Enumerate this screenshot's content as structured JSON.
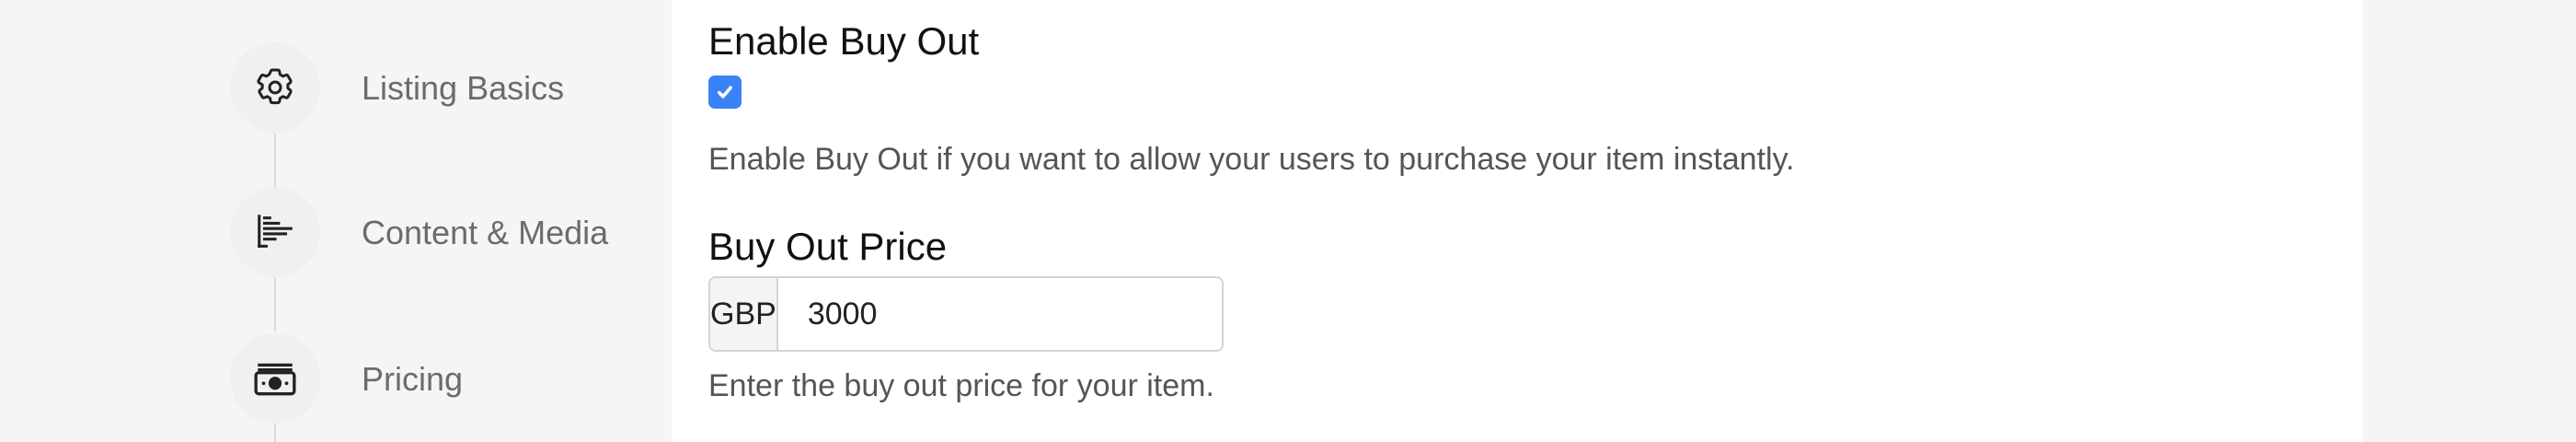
{
  "steps": [
    {
      "label": "Listing Basics",
      "icon": "gear-icon"
    },
    {
      "label": "Content & Media",
      "icon": "content-lines-icon"
    },
    {
      "label": "Pricing",
      "icon": "banknote-icon"
    }
  ],
  "buy_out": {
    "title": "Enable Buy Out",
    "checked": true,
    "help": "Enable Buy Out if you want to allow your users to purchase your item instantly."
  },
  "buy_out_price": {
    "title": "Buy Out Price",
    "currency": "GBP",
    "value": "3000",
    "help": "Enter the buy out price for your item."
  },
  "colors": {
    "accent": "#3b82f6",
    "background": "#f5f5f5",
    "panel": "#ffffff"
  }
}
